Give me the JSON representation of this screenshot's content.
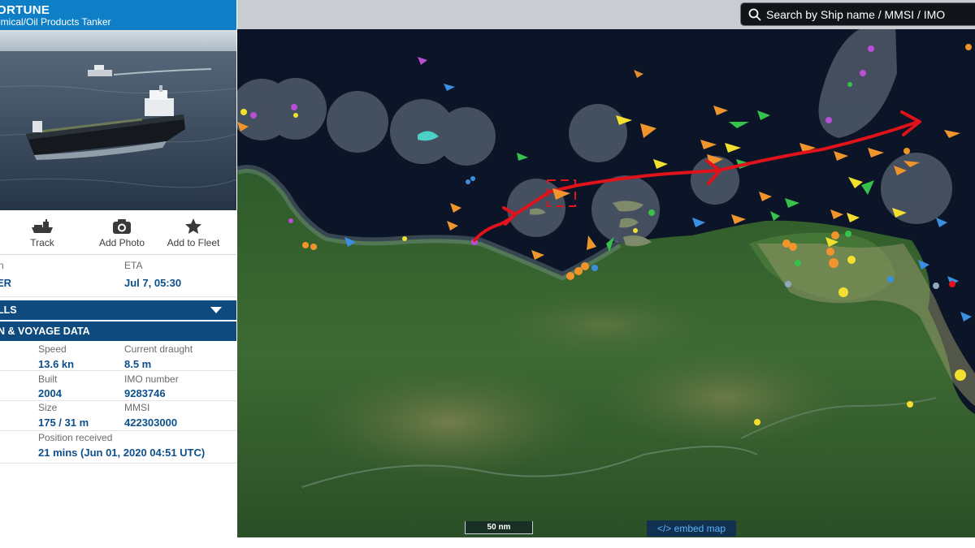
{
  "panel": {
    "ship_name": "ORTUNE",
    "ship_type": "emical/Oil Products Tanker",
    "actions": [
      {
        "label": "Track",
        "icon": "ship-icon"
      },
      {
        "label": "Add Photo",
        "icon": "camera-icon"
      },
      {
        "label": "Add to Fleet",
        "icon": "star-icon"
      }
    ],
    "destination": {
      "label": "n",
      "value": "ER"
    },
    "eta": {
      "label": "ETA",
      "value": "Jul 7, 05:30"
    },
    "sections": {
      "calls": "LLS",
      "voyage": "N & VOYAGE DATA"
    },
    "fields": {
      "speed": {
        "label": "Speed",
        "value": "13.6 kn"
      },
      "draught": {
        "label": "Current draught",
        "value": "8.5 m"
      },
      "built": {
        "label": "Built",
        "value": "2004"
      },
      "imo": {
        "label": "IMO number",
        "value": "9283746"
      },
      "size": {
        "label": "Size",
        "value": "175 / 31 m"
      },
      "mmsi": {
        "label": "MMSI",
        "value": "422303000"
      },
      "position": {
        "label": "Position received",
        "value": "21 mins (Jun 01, 2020 04:51 UTC)"
      }
    }
  },
  "map": {
    "search_placeholder": "Search by Ship name / MMSI / IMO",
    "scale_label": "50 nm",
    "embed_label": "</> embed map",
    "route_color": "#e0121a",
    "selection_color": "#e0121a"
  }
}
